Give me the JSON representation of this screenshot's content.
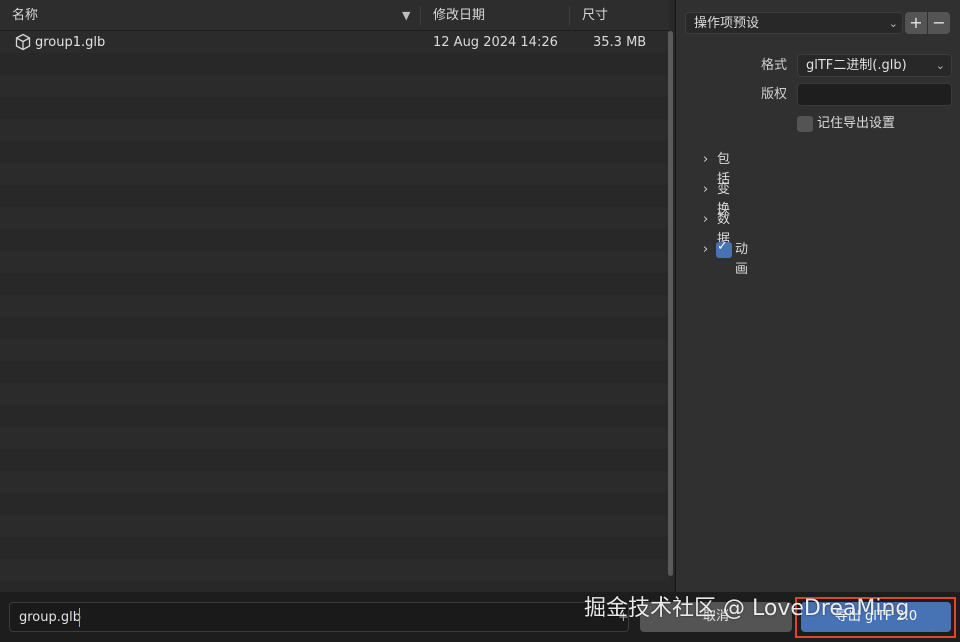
{
  "file_list": {
    "columns": {
      "name": "名称",
      "modified": "修改日期",
      "size": "尺寸"
    },
    "files": [
      {
        "name": "group1.glb",
        "modified": "12 Aug 2024 14:26",
        "size": "35.3 MB",
        "icon": "cube-icon"
      }
    ]
  },
  "settings": {
    "preset_label": "操作项预设",
    "add_preset": "+",
    "remove_preset": "−",
    "format_label": "格式",
    "format_value": "glTF二进制(.glb)",
    "copyright_label": "版权",
    "copyright_value": "",
    "remember_label": "记住导出设置",
    "remember_checked": false,
    "sections": [
      {
        "label": "包括"
      },
      {
        "label": "变换"
      },
      {
        "label": "数据"
      },
      {
        "label": "动画",
        "checked": true
      }
    ]
  },
  "footer": {
    "filename": "group.glb",
    "cancel_label": "取消",
    "export_label": "导出 glTF 2.0"
  },
  "watermark": "掘金技术社区 @ LoveDreaMing",
  "colors": {
    "accent": "#4772b3",
    "highlight": "#e0452b"
  }
}
